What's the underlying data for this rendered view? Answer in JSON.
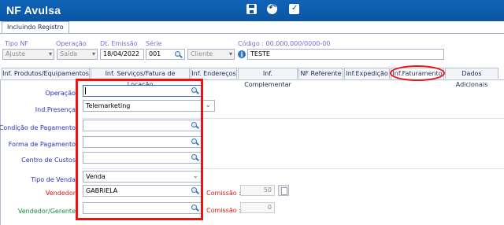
{
  "app": {
    "title": "NF Avulsa"
  },
  "toolbar": {
    "icons": [
      "save-icon",
      "undo-icon",
      "document-check-icon"
    ]
  },
  "status_tab": "Incluindo Registro",
  "header": {
    "tipo_nf": {
      "label": "Tipo NF",
      "value": "Ajuste"
    },
    "operacao": {
      "label": "Operação",
      "value": "Saída"
    },
    "dt_emissao": {
      "label": "Dt. Emissão",
      "value": "18/04/2022"
    },
    "serie": {
      "label": "Série",
      "value": "001"
    },
    "destinatario_tipo": {
      "value": "Cliente"
    },
    "codigo": {
      "label": "Código : 00.000.000/0000-00",
      "value": "TESTE"
    }
  },
  "tabs": [
    {
      "label": "Inf. Produtos/Equipamentos"
    },
    {
      "label": "Inf. Serviços/Fatura de Locação"
    },
    {
      "label": "Inf. Endereços"
    },
    {
      "label": "Inf. Complementar"
    },
    {
      "label": "NF Referente"
    },
    {
      "label": "Inf.Expedição"
    },
    {
      "label": "Inf.Faturamento",
      "active": true
    },
    {
      "label": "Dados Adicionais"
    }
  ],
  "form": {
    "operacao": {
      "label": "Operação",
      "value": ""
    },
    "ind_presenca": {
      "label": "Ind.Presença",
      "value": "Telemarketing"
    },
    "condicao_pagamento": {
      "label": "Condição de Pagamento",
      "value": ""
    },
    "forma_pagamento": {
      "label": "Forma de Pagamento",
      "value": ""
    },
    "centro_custos": {
      "label": "Centro de Custos",
      "value": ""
    },
    "tipo_venda": {
      "label": "Tipo de Venda",
      "value": "Venda"
    },
    "vendedor": {
      "label": "Vendedor",
      "value": "GABRIELA",
      "comissao_label": "Comissão :",
      "comissao": "50"
    },
    "vendedor_gerente": {
      "label": "Vendedor/Gerente",
      "value": "",
      "comissao_label": "Comissão :",
      "comissao": "0"
    }
  },
  "colors": {
    "title_bar": "#0a55a3",
    "highlight": "#e11111",
    "label_blue": "#2a2fb3",
    "label_red": "#e11111",
    "label_green": "#168a3c"
  }
}
